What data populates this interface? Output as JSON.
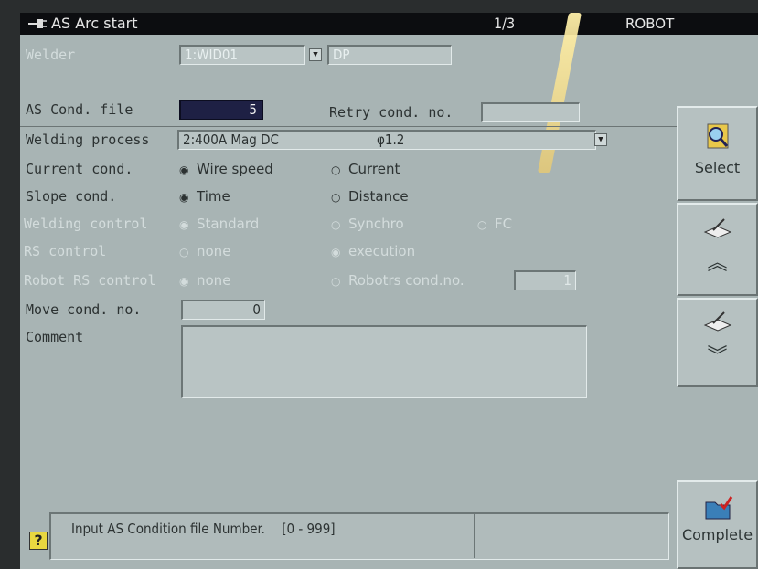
{
  "titlebar": {
    "icon": "plug-icon",
    "title": "AS Arc start",
    "page": "1/3",
    "mode": "ROBOT"
  },
  "welder": {
    "label": "Welder",
    "value": "1:WID01",
    "extra": "DP"
  },
  "as_cond": {
    "label": "AS Cond. file",
    "value": "5",
    "retry_label": "Retry cond. no.",
    "retry_value": ""
  },
  "welding_process": {
    "label": "Welding process",
    "value": "2:400A Mag DC",
    "diameter": "φ1.2"
  },
  "current_cond": {
    "label": "Current cond.",
    "opt1": "Wire speed",
    "opt2": "Current"
  },
  "slope_cond": {
    "label": "Slope cond.",
    "opt1": "Time",
    "opt2": "Distance"
  },
  "welding_control": {
    "label": "Welding control",
    "opt1": "Standard",
    "opt2": "Synchro",
    "opt3": "FC"
  },
  "rs_control": {
    "label": "RS control",
    "opt1": "none",
    "opt2": "execution"
  },
  "robot_rs_control": {
    "label": "Robot RS control",
    "opt1": "none",
    "opt2": "Robotrs cond.no.",
    "value": "1"
  },
  "move_cond": {
    "label": "Move cond. no.",
    "value": "0"
  },
  "comment": {
    "label": "Comment",
    "value": ""
  },
  "side": {
    "select_label": "Select",
    "complete_label": "Complete"
  },
  "message": {
    "text": "Input AS Condition file Number.",
    "range": "[0 - 999]",
    "help_icon": "?"
  },
  "colors": {
    "screen": "#a8b4b4",
    "titlebar": "#0c0d10",
    "selected_field": "#1e2044",
    "help": "#e8d740"
  }
}
